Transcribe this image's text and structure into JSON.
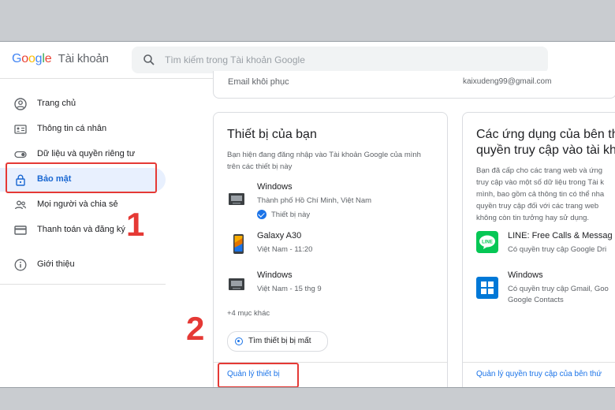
{
  "header": {
    "logo_letters": [
      "G",
      "o",
      "o",
      "g",
      "l",
      "e"
    ],
    "product": "Tài khoản",
    "search_placeholder": "Tìm kiếm trong Tài khoản Google"
  },
  "sidebar": {
    "items": [
      {
        "label": "Trang chủ",
        "icon": "account-circle-icon"
      },
      {
        "label": "Thông tin cá nhân",
        "icon": "id-card-icon"
      },
      {
        "label": "Dữ liệu và quyền riêng tư",
        "icon": "toggle-icon"
      },
      {
        "label": "Bảo mật",
        "icon": "lock-icon",
        "active": true
      },
      {
        "label": "Mọi người và chia sẻ",
        "icon": "people-icon"
      },
      {
        "label": "Thanh toán và đăng ký",
        "icon": "credit-card-icon"
      },
      {
        "label": "Giới thiệu",
        "icon": "info-icon"
      }
    ]
  },
  "annotations": {
    "step1": "1",
    "step2": "2",
    "color": "#e53935"
  },
  "email_row": {
    "label": "Email khôi phục",
    "value": "kaixudeng99@gmail.com"
  },
  "devices_card": {
    "title": "Thiết bị của bạn",
    "description": "Bạn hiện đang đăng nhập vào Tài khoản Google của mình trên các thiết bị này",
    "devices": [
      {
        "name": "Windows",
        "location": "Thành phố Hồ Chí Minh, Việt Nam",
        "this_device": "Thiết bị này",
        "icon": "laptop-icon"
      },
      {
        "name": "Galaxy A30",
        "location": "Việt Nam - 11:20",
        "icon": "phone-icon"
      },
      {
        "name": "Windows",
        "location": "Việt Nam - 15 thg 9",
        "icon": "laptop-icon"
      }
    ],
    "more": "+4 mục khác",
    "find_button": "Tìm thiết bị bị mất",
    "manage_link": "Quản lý thiết bị"
  },
  "apps_card": {
    "title_line1": "Các ứng dụng của bên th",
    "title_line2": "quyền truy cập vào tài kh",
    "description_lines": [
      "Bạn đã cấp cho các trang web và ứng",
      "truy cập vào một số dữ liệu trong Tài k",
      "mình, bao gồm cả thông tin có thể nha",
      "quyền truy cập đối với các trang web",
      "không còn tin tưởng hay sử dụng."
    ],
    "apps": [
      {
        "name": "LINE: Free Calls & Messag",
        "desc": [
          "Có quyền truy cập Google Dri"
        ],
        "icon": "line-app-icon",
        "color": "#06c755"
      },
      {
        "name": "Windows",
        "desc": [
          "Có quyền truy cập Gmail, Goo",
          "Google Contacts"
        ],
        "icon": "windows-logo-icon",
        "color": "#0078d7"
      }
    ],
    "manage_link": "Quản lý quyền truy cập của bên thứ"
  }
}
